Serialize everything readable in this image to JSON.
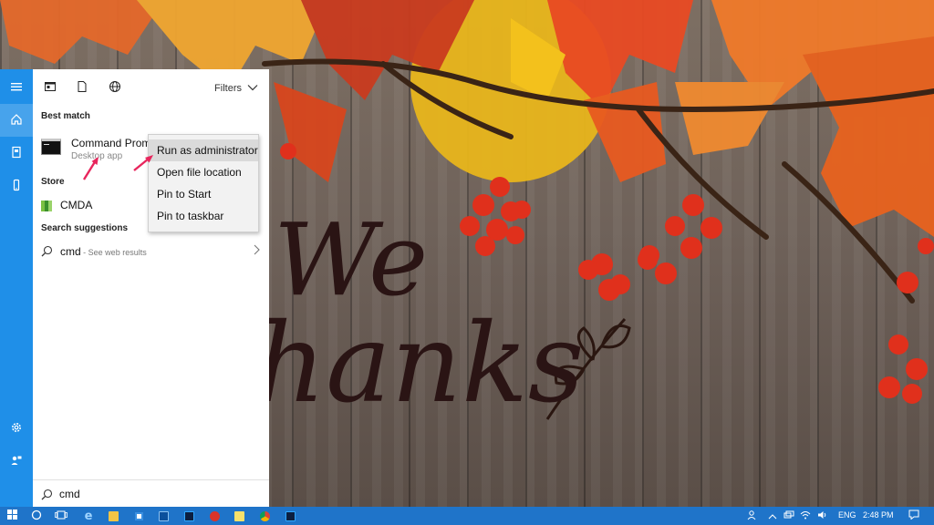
{
  "wallpaper": {
    "script_text_line1": "We",
    "script_text_line2": "hanks"
  },
  "rail": {
    "items": [
      {
        "name": "hamburger",
        "icon": "menu-icon"
      },
      {
        "name": "home",
        "icon": "home-icon"
      },
      {
        "name": "documents",
        "icon": "notebook-icon"
      },
      {
        "name": "device",
        "icon": "phone-icon"
      },
      {
        "name": "settings",
        "icon": "gear-icon"
      },
      {
        "name": "feedback",
        "icon": "feedback-icon"
      }
    ]
  },
  "toolbar": {
    "filters_label": "Filters"
  },
  "best_match": {
    "section_label": "Best match",
    "title": "Command Prompt",
    "subtitle": "Desktop app"
  },
  "store": {
    "section_label": "Store",
    "item_label": "CMDA"
  },
  "suggestions": {
    "section_label": "Search suggestions",
    "query": "cmd",
    "hint": " - See web results"
  },
  "search": {
    "value": "cmd"
  },
  "context_menu": {
    "items": [
      "Run as administrator",
      "Open file location",
      "Pin to Start",
      "Pin to taskbar"
    ]
  },
  "taskbar": {
    "language": "ENG",
    "time": "2:48 PM"
  },
  "colors": {
    "rail_blue": "#1f8fe8",
    "taskbar_blue": "#1f74c9",
    "annotation_arrow": "#e8265d"
  }
}
